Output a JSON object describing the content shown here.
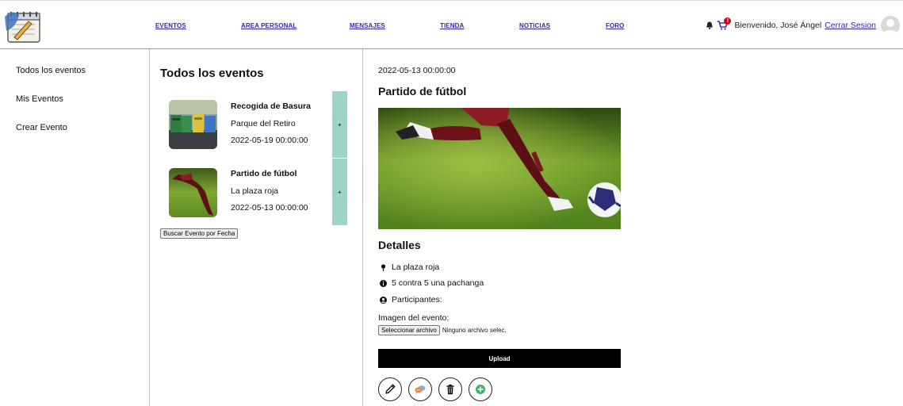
{
  "header": {
    "nav": [
      {
        "label": "EVENTOS"
      },
      {
        "label": "AREA PERSONAL"
      },
      {
        "label": "MENSAJES"
      },
      {
        "label": "TIENDA"
      },
      {
        "label": "NOTICIAS"
      },
      {
        "label": "FORO"
      }
    ],
    "cart_badge": "!",
    "welcome": "Bienvenido, José Ángel",
    "logout": "Cerrar Sesion"
  },
  "sidebar": {
    "items": [
      {
        "label": "Todos los eventos"
      },
      {
        "label": "Mis Eventos"
      },
      {
        "label": "Crear Evento"
      }
    ]
  },
  "list": {
    "title": "Todos los eventos",
    "events": [
      {
        "name": "Recogida de Basura",
        "place": "Parque del Retiro",
        "date": "2022-05-19 00:00:00",
        "action": "+"
      },
      {
        "name": "Partido de fútbol",
        "place": "La plaza roja",
        "date": "2022-05-13 00:00:00",
        "action": "+"
      }
    ],
    "search_button": "Buscar Evento por Fecha"
  },
  "detail": {
    "date": "2022-05-13 00:00:00",
    "title": "Partido de fútbol",
    "details_heading": "Detalles",
    "location": "La plaza roja",
    "description": "5 contra 5 una pachanga",
    "participants": "Participantes:",
    "image_label": "Imagen del evento:",
    "file_button": "Seleccionar archivo",
    "file_status": "Ninguno archivo selec.",
    "upload": "Upload"
  },
  "colors": {
    "nav_link": "#3a27a8",
    "plus_bar": "#9ed3c8",
    "badge": "#d0021b",
    "upload_bg": "#000000"
  },
  "icons": [
    "bell-icon",
    "cart-icon",
    "avatar-icon",
    "pin-icon",
    "info-icon",
    "user-icon",
    "pencil-icon",
    "chat-icon",
    "trash-icon",
    "add-icon"
  ]
}
